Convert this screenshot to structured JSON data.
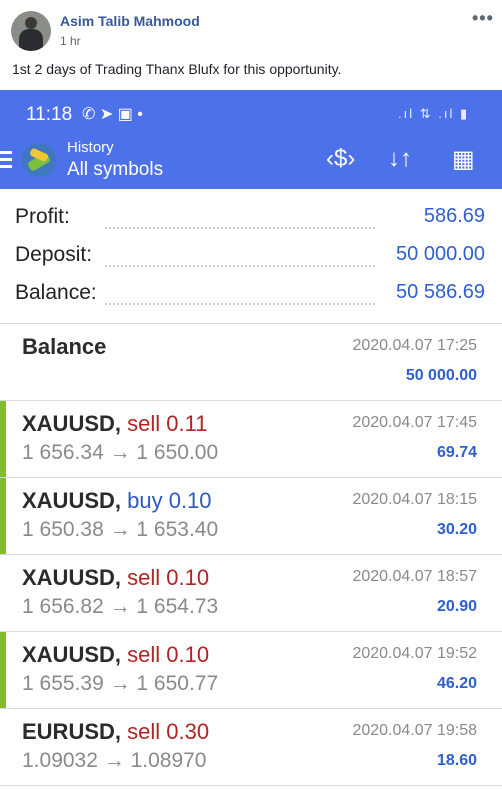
{
  "post": {
    "author": "Asim Talib Mahmood",
    "time": "1 hr",
    "more": "•••",
    "text": "1st 2 days of Trading Thanx Blufx for this opportunity."
  },
  "status_bar": {
    "time": "11:18",
    "icons_left": "✆ ➤ ▣ •",
    "icons_right": ".ıl ⇅ .ıl ▮"
  },
  "app_bar": {
    "title": "History",
    "subtitle": "All symbols",
    "icon_currency": "‹$›",
    "icon_sort": "↓↑",
    "icon_calendar": "▦"
  },
  "summary": [
    {
      "label": "Profit:",
      "value": "586.69"
    },
    {
      "label": "Deposit:",
      "value": "50 000.00"
    },
    {
      "label": "Balance:",
      "value": "50 586.69"
    }
  ],
  "balance_entry": {
    "label": "Balance",
    "date": "2020.04.07 17:25",
    "amount": "50 000.00"
  },
  "trades": [
    {
      "symbol": "XAUUSD,",
      "side": "sell 0.11",
      "side_type": "sell",
      "prices": "1 656.34 → 1 650.00",
      "date": "2020.04.07 17:45",
      "amount": "69.74",
      "accent": true
    },
    {
      "symbol": "XAUUSD,",
      "side": "buy 0.10",
      "side_type": "buy",
      "prices": "1 650.38 → 1 653.40",
      "date": "2020.04.07 18:15",
      "amount": "30.20",
      "accent": true
    },
    {
      "symbol": "XAUUSD,",
      "side": "sell 0.10",
      "side_type": "sell",
      "prices": "1 656.82 → 1 654.73",
      "date": "2020.04.07 18:57",
      "amount": "20.90",
      "accent": false
    },
    {
      "symbol": "XAUUSD,",
      "side": "sell 0.10",
      "side_type": "sell",
      "prices": "1 655.39 → 1 650.77",
      "date": "2020.04.07 19:52",
      "amount": "46.20",
      "accent": true
    },
    {
      "symbol": "EURUSD,",
      "side": "sell 0.30",
      "side_type": "sell",
      "prices": "1.09032 → 1.08970",
      "date": "2020.04.07 19:58",
      "amount": "18.60",
      "accent": false
    }
  ],
  "colors": {
    "app_blue": "#4d71e8",
    "value_blue": "#2f5fcf",
    "sell_red": "#b02424",
    "buy_blue": "#2e58c6",
    "profit_accent": "#85bb2a"
  }
}
